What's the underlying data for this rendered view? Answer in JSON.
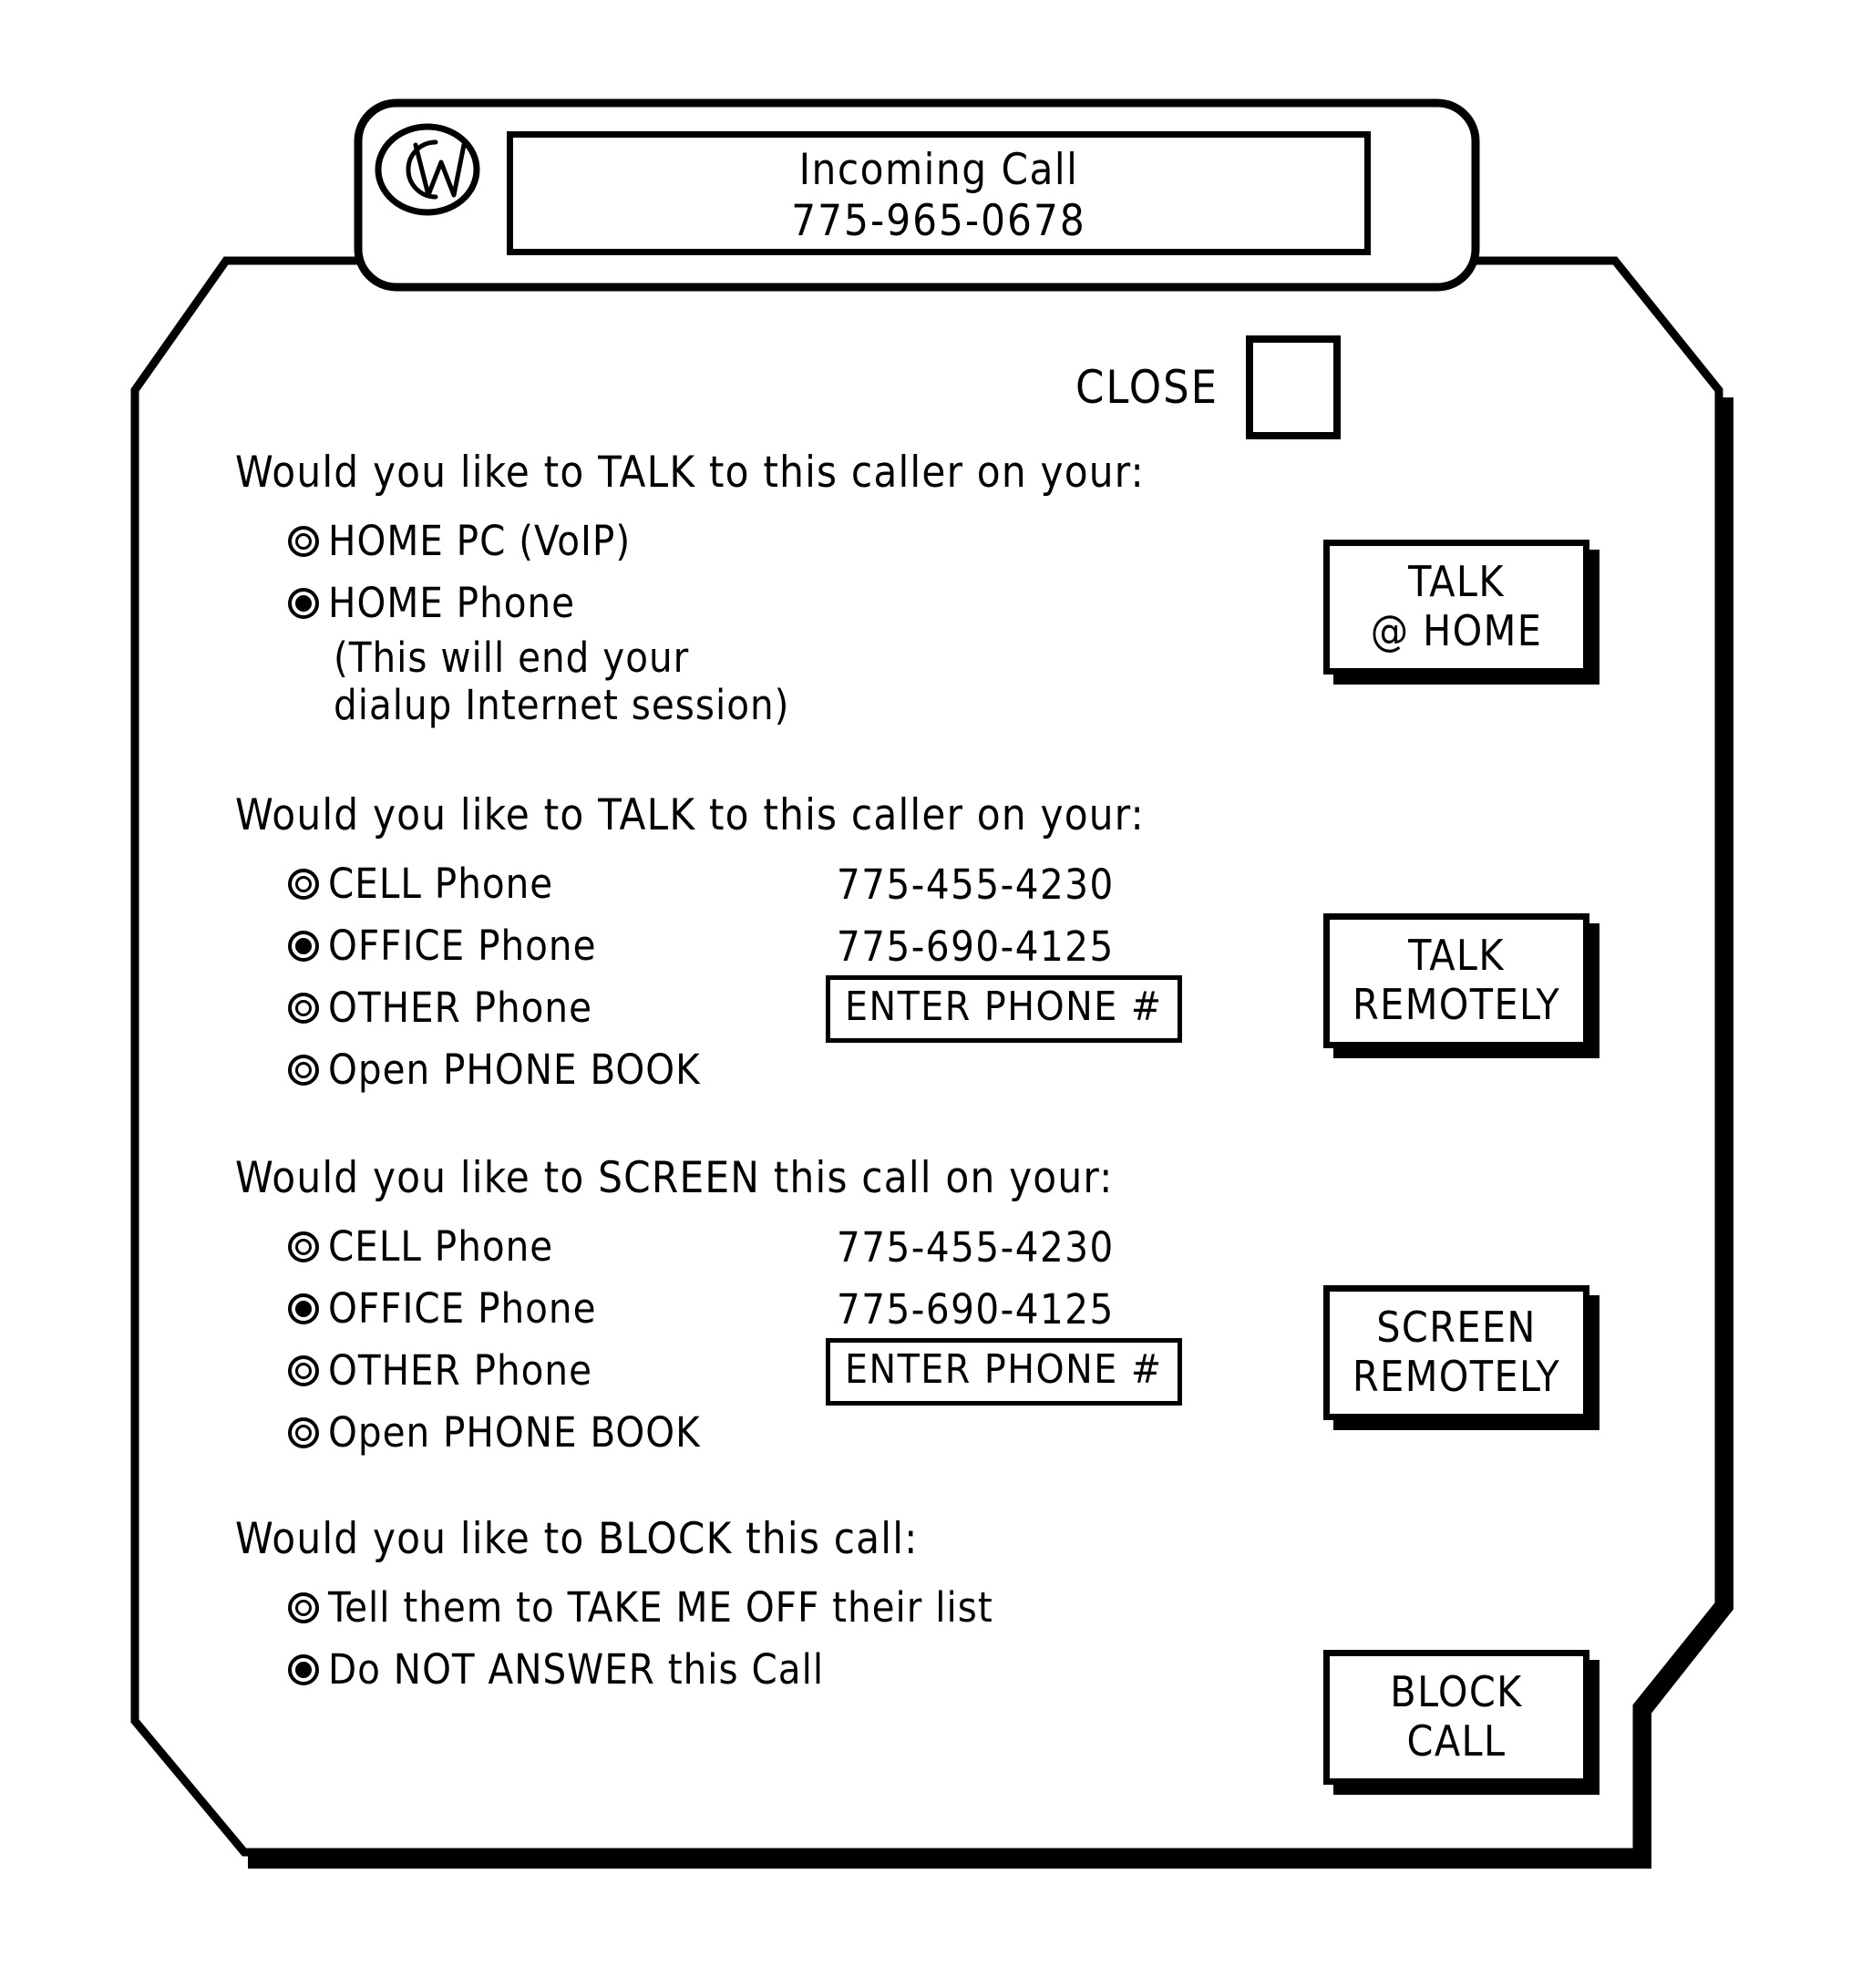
{
  "header": {
    "logo_icon": "cw-monogram-icon",
    "logo_letters": "CW",
    "display": {
      "line1": "Incoming Call",
      "line2": "775-965-0678"
    }
  },
  "close": {
    "label": "CLOSE",
    "button_icon": "close-square-button"
  },
  "sections": [
    {
      "id": "talk-home",
      "heading": "Would you like to TALK to this caller on your:",
      "options": [
        {
          "label": "HOME PC (VoIP)",
          "selected": false,
          "value": ""
        },
        {
          "label": "HOME Phone",
          "selected": true,
          "value": ""
        }
      ],
      "note": [
        "(This will end your",
        "dialup Internet session)"
      ],
      "action": {
        "line1": "TALK",
        "line2": "@ HOME"
      }
    },
    {
      "id": "talk-remote",
      "heading": "Would you like to TALK to this caller on your:",
      "options": [
        {
          "label": "CELL Phone",
          "selected": false,
          "value": "775-455-4230"
        },
        {
          "label": "OFFICE Phone",
          "selected": true,
          "value": "775-690-4125"
        },
        {
          "label": "OTHER Phone",
          "selected": false,
          "value": "",
          "input": "ENTER PHONE #"
        },
        {
          "label": "Open PHONE BOOK",
          "selected": false,
          "value": ""
        }
      ],
      "action": {
        "line1": "TALK",
        "line2": "REMOTELY"
      }
    },
    {
      "id": "screen-remote",
      "heading": "Would you like to SCREEN this call on your:",
      "options": [
        {
          "label": "CELL Phone",
          "selected": false,
          "value": "775-455-4230"
        },
        {
          "label": "OFFICE Phone",
          "selected": true,
          "value": "775-690-4125"
        },
        {
          "label": "OTHER Phone",
          "selected": false,
          "value": "",
          "input": "ENTER PHONE #"
        },
        {
          "label": "Open PHONE BOOK",
          "selected": false,
          "value": ""
        }
      ],
      "action": {
        "line1": "SCREEN",
        "line2": "REMOTELY"
      }
    },
    {
      "id": "block-call",
      "heading": "Would you like to BLOCK this call:",
      "options": [
        {
          "label": "Tell them to TAKE ME OFF their list",
          "selected": false,
          "value": ""
        },
        {
          "label": "Do NOT ANSWER this Call",
          "selected": true,
          "value": ""
        }
      ],
      "action": {
        "line1": "BLOCK",
        "line2": "CALL"
      }
    }
  ],
  "colors": {
    "ink": "#000000",
    "paper": "#ffffff"
  }
}
